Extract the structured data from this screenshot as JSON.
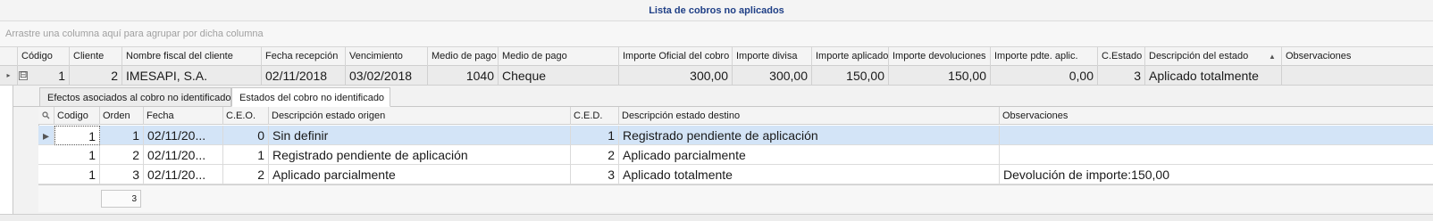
{
  "window": {
    "title": "Lista de cobros no aplicados"
  },
  "group_panel": {
    "hint": "Arrastre una columna aquí para agrupar por dicha columna"
  },
  "main_grid": {
    "columns": [
      "Código",
      "Cliente",
      "Nombre fiscal del cliente",
      "Fecha recepción",
      "Vencimiento",
      "Medio de pago",
      "Medio de pago",
      "Importe Oficial del cobro",
      "Importe divisa",
      "Importe aplicado",
      "Importe devoluciones",
      "Importe pdte. aplic.",
      "C.Estado",
      "Descripción del estado",
      "Observaciones"
    ],
    "row": {
      "codigo": "1",
      "cliente": "2",
      "nombre_fiscal": "IMESAPI, S.A.",
      "fecha_recepcion": "02/11/2018",
      "vencimiento": "03/02/2018",
      "medio_pago_cod": "1040",
      "medio_pago": "Cheque",
      "importe_oficial": "300,00",
      "importe_divisa": "300,00",
      "importe_aplicado": "150,00",
      "importe_devoluciones": "150,00",
      "importe_pdte": "0,00",
      "c_estado": "3",
      "descripcion_estado": "Aplicado totalmente",
      "observaciones": ""
    },
    "sort_indicator": "▲",
    "row_indicator": "▸",
    "expander": "⊟"
  },
  "detail": {
    "tabs": [
      "Efectos asociados al cobro no identificado",
      "Estados del cobro no identificado"
    ],
    "active_tab": "Estados del cobro no identificado",
    "columns": [
      "Codigo",
      "Orden",
      "Fecha",
      "C.E.O.",
      "Descripción estado origen",
      "C.E.D.",
      "Descripción estado destino",
      "Observaciones"
    ],
    "rows": [
      {
        "codigo": "1",
        "orden": "1",
        "fecha": "02/11/20...",
        "ceo": "0",
        "desc_origen": "Sin definir",
        "ced": "1",
        "desc_destino": "Registrado pendiente de aplicación",
        "observaciones": ""
      },
      {
        "codigo": "1",
        "orden": "2",
        "fecha": "02/11/20...",
        "ceo": "1",
        "desc_origen": "Registrado pendiente de aplicación",
        "ced": "2",
        "desc_destino": "Aplicado parcialmente",
        "observaciones": ""
      },
      {
        "codigo": "1",
        "orden": "3",
        "fecha": "02/11/20...",
        "ceo": "2",
        "desc_origen": "Aplicado parcialmente",
        "ced": "3",
        "desc_destino": "Aplicado totalmente",
        "observaciones": "Devolución de importe:150,00"
      }
    ],
    "footer_count": "3",
    "search_icon": "search-icon",
    "row_indicator": "▸"
  },
  "colors": {
    "title": "#1f3f86",
    "selected_row": "#d3e4f7",
    "header_bg": "#f4f4f4"
  }
}
